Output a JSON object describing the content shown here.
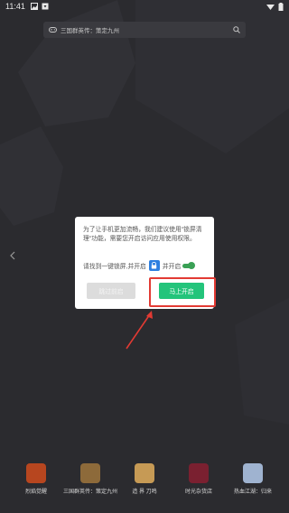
{
  "status_bar": {
    "time": "11:41",
    "icons": [
      "image-icon",
      "download-icon",
      "wifi-icon",
      "battery-icon"
    ]
  },
  "search": {
    "placeholder": "三国群英传：策定九州"
  },
  "dialog": {
    "message": "为了让手机更加流畅，我们建议使用\"锁屏清理\"功能，需要您开启访问应用使用权限。",
    "instruction_prefix": "请找到一键锁屏,并开启",
    "instruction_suffix": "并开启",
    "skip_label": "跳过前启",
    "open_label": "马上开启"
  },
  "dock": {
    "items": [
      {
        "label": "烈焰觉醒",
        "color": "#b7461f"
      },
      {
        "label": "三国群英传：策定九州",
        "color": "#8d6a3a"
      },
      {
        "label": "造 界 刀鸣",
        "color": "#c69a55"
      },
      {
        "label": "时光杂货店",
        "color": "#7a2030"
      },
      {
        "label": "热血江湖：归来",
        "color": "#9fb3d0"
      }
    ]
  },
  "colors": {
    "background": "#2b2b2f",
    "accent_green": "#23c47b",
    "highlight_red": "#e23a33"
  }
}
